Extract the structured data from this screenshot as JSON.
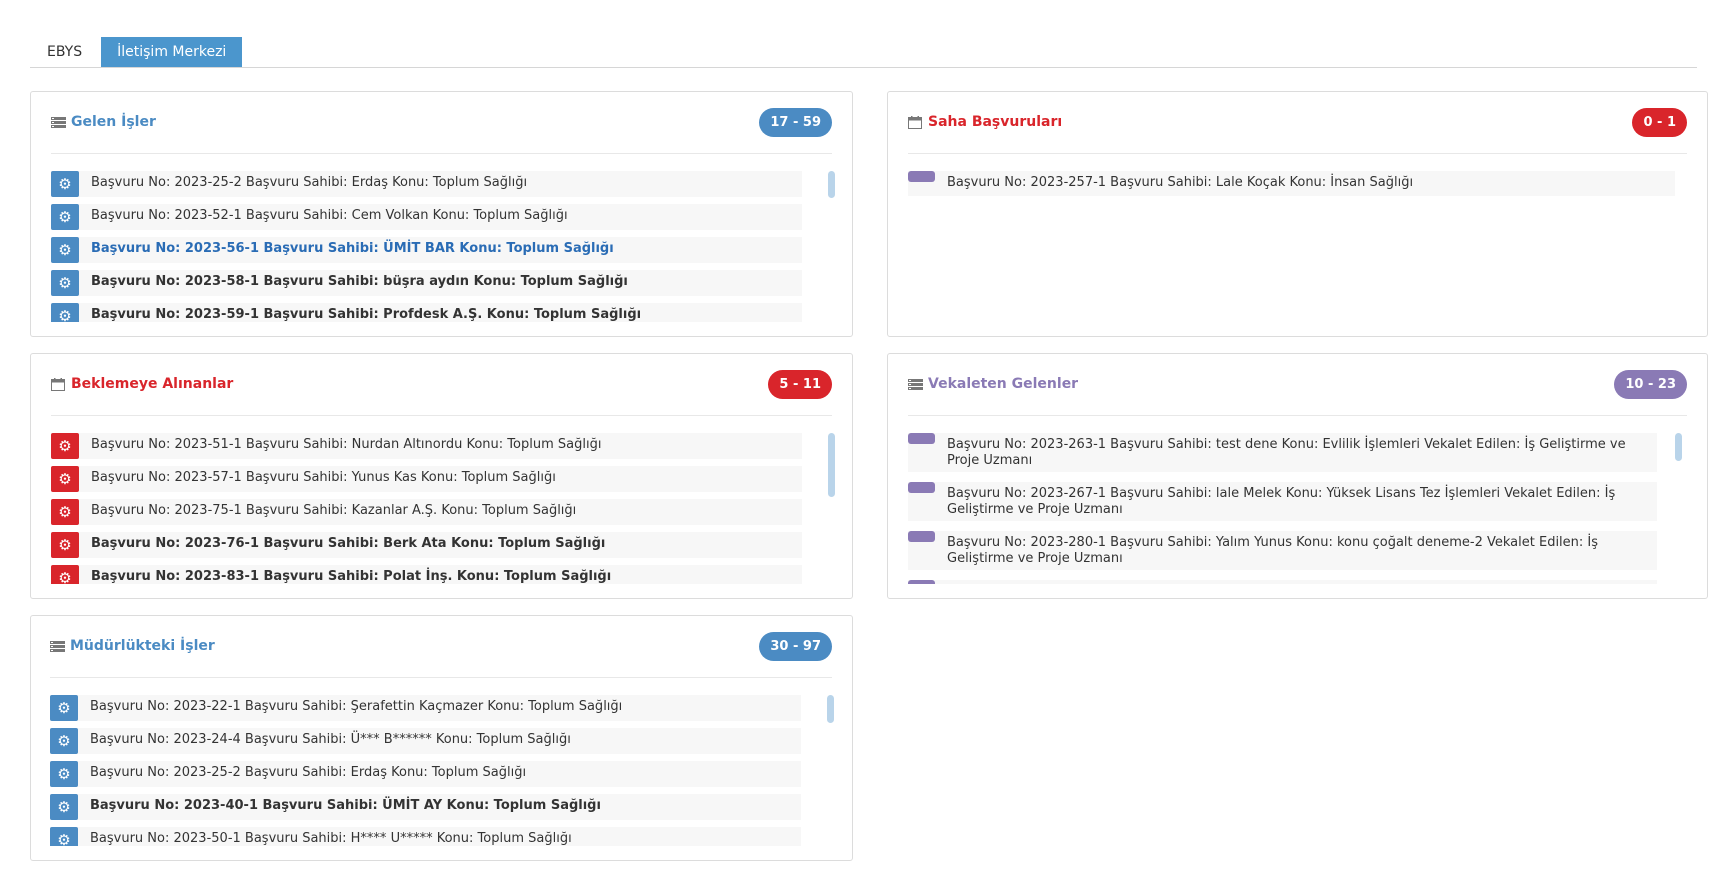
{
  "tabs": [
    {
      "label": "EBYS",
      "active": false
    },
    {
      "label": "İletişim Merkezi",
      "active": true
    }
  ],
  "colors": {
    "accent_blue": "#4b96cd",
    "badge_blue": "#4b8bc3",
    "badge_red": "#d9252b",
    "badge_purple": "#8a7ab5"
  },
  "panels": {
    "gelen": {
      "title": "Gelen İşler",
      "badge": "17 - 59",
      "items": [
        {
          "text": "Başvuru No: 2023-25-2 Başvuru Sahibi: Erdaş Konu: Toplum Sağlığı"
        },
        {
          "text": "Başvuru No: 2023-52-1 Başvuru Sahibi: Cem Volkan Konu: Toplum Sağlığı"
        },
        {
          "text": "Başvuru No: 2023-56-1 Başvuru Sahibi: ÜMİT BAR Konu: Toplum Sağlığı"
        },
        {
          "text": "Başvuru No: 2023-58-1 Başvuru Sahibi: büşra aydın Konu: Toplum Sağlığı"
        },
        {
          "text": "Başvuru No: 2023-59-1 Başvuru Sahibi: Profdesk A.Ş. Konu: Toplum Sağlığı"
        }
      ]
    },
    "saha": {
      "title": "Saha Başvuruları",
      "badge": "0 - 1",
      "items": [
        {
          "text": "Başvuru No: 2023-257-1 Başvuru Sahibi: Lale Koçak Konu: İnsan Sağlığı"
        }
      ]
    },
    "beklemeye": {
      "title": "Beklemeye Alınanlar",
      "badge": "5 - 11",
      "items": [
        {
          "text": "Başvuru No: 2023-51-1 Başvuru Sahibi: Nurdan Altınordu Konu: Toplum Sağlığı"
        },
        {
          "text": "Başvuru No: 2023-57-1 Başvuru Sahibi: Yunus Kas Konu: Toplum Sağlığı"
        },
        {
          "text": "Başvuru No: 2023-75-1 Başvuru Sahibi: Kazanlar A.Ş. Konu: Toplum Sağlığı"
        },
        {
          "text": "Başvuru No: 2023-76-1 Başvuru Sahibi: Berk Ata Konu: Toplum Sağlığı"
        },
        {
          "text": "Başvuru No: 2023-83-1 Başvuru Sahibi: Polat İnş. Konu: Toplum Sağlığı"
        }
      ]
    },
    "vekaleten": {
      "title": "Vekaleten Gelenler",
      "badge": "10 - 23",
      "items": [
        {
          "text": "Başvuru No: 2023-263-1 Başvuru Sahibi: test dene Konu: Evlilik İşlemleri Vekalet Edilen: İş Geliştirme ve Proje Uzmanı"
        },
        {
          "text": "Başvuru No: 2023-267-1 Başvuru Sahibi: lale Melek Konu: Yüksek Lisans Tez İşlemleri Vekalet Edilen: İş Geliştirme ve Proje Uzmanı"
        },
        {
          "text": "Başvuru No: 2023-280-1 Başvuru Sahibi: Yalım Yunus Konu: konu çoğalt deneme-2 Vekalet Edilen: İş Geliştirme ve Proje Uzmanı"
        }
      ]
    },
    "mudurluk": {
      "title": "Müdürlükteki İşler",
      "badge": "30 - 97",
      "items": [
        {
          "text": "Başvuru No: 2023-22-1 Başvuru Sahibi: Şerafettin Kaçmazer Konu: Toplum Sağlığı"
        },
        {
          "text": "Başvuru No: 2023-24-4 Başvuru Sahibi: Ü*** B****** Konu: Toplum Sağlığı"
        },
        {
          "text": "Başvuru No: 2023-25-2 Başvuru Sahibi: Erdaş Konu: Toplum Sağlığı"
        },
        {
          "text": "Başvuru No: 2023-40-1 Başvuru Sahibi: ÜMİT AY Konu: Toplum Sağlığı"
        },
        {
          "text": "Başvuru No: 2023-50-1 Başvuru Sahibi: H**** U***** Konu: Toplum Sağlığı"
        }
      ]
    }
  }
}
